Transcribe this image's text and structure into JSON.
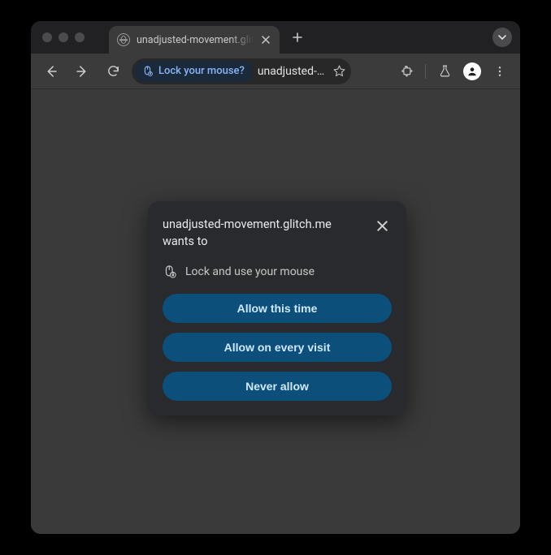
{
  "tab": {
    "title": "unadjusted-movement.glitch."
  },
  "omnibox": {
    "chip_label": "Lock your mouse?",
    "url": "unadjusted-mov…"
  },
  "dialog": {
    "title": "unadjusted-movement.glitch.me wants to",
    "permission_label": "Lock and use your mouse",
    "buttons": {
      "allow_once": "Allow this time",
      "allow_always": "Allow on every visit",
      "never": "Never allow"
    }
  }
}
